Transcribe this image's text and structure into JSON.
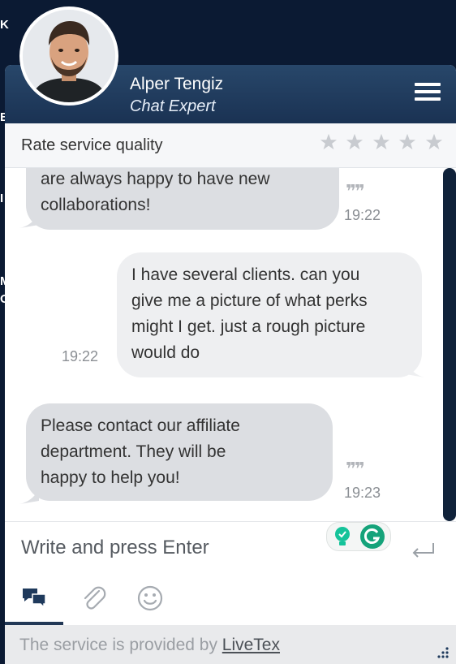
{
  "background": {
    "letters": [
      "K",
      "E",
      "I",
      "M",
      "O"
    ]
  },
  "agent": {
    "name": "Alper Tengiz",
    "role": "Chat Expert"
  },
  "rating": {
    "label": "Rate service quality",
    "value": 0,
    "max": 5
  },
  "messages": [
    {
      "direction": "in",
      "lines": [
        "are always happy to have new",
        "collaborations!"
      ],
      "time": "19:22",
      "read_icon": "double-quote-check-icon"
    },
    {
      "direction": "out",
      "lines": [
        "I have several clients. can you",
        "give me a picture of what perks",
        "might I get. just a rough picture",
        "would do"
      ],
      "time": "19:22"
    },
    {
      "direction": "in",
      "lines": [
        "Please contact our affiliate",
        "department. They will be",
        "happy to help you!"
      ],
      "time": "19:23",
      "read_icon": "double-quote-check-icon"
    }
  ],
  "input": {
    "placeholder": "Write and press Enter",
    "value": ""
  },
  "toolbar": {
    "items": [
      "chat-icon",
      "attachment-icon",
      "emoji-icon"
    ],
    "active": "chat-icon"
  },
  "footer": {
    "text": "The service is provided by ",
    "link": "LiveTex"
  },
  "colors": {
    "header": "#1f3a5c",
    "background": "#0b1a33",
    "bubble_in": "#dcdee2",
    "bubble_out": "#eeeff1",
    "accent": "#223856"
  }
}
